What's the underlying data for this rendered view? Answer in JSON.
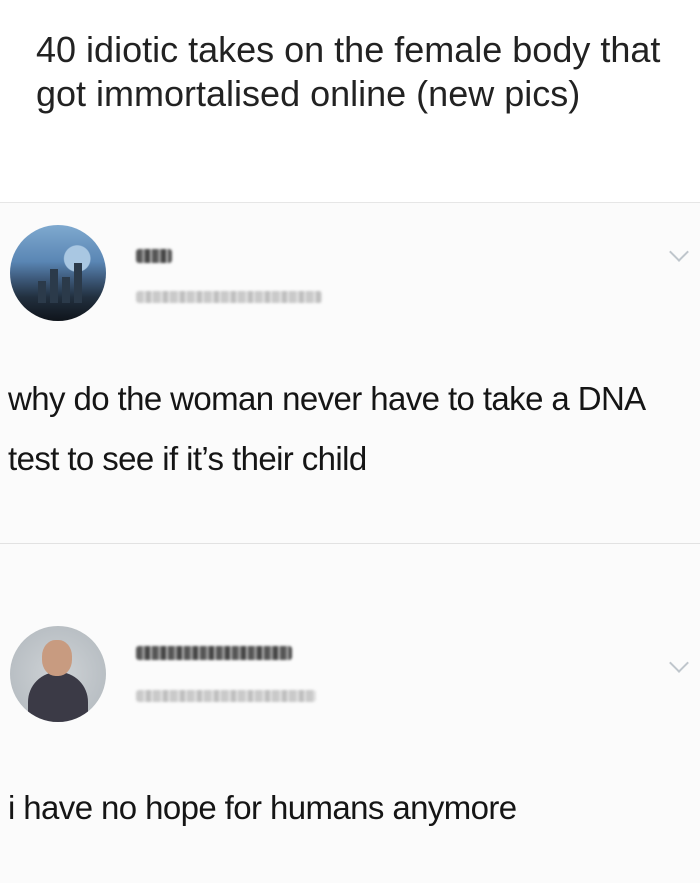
{
  "article": {
    "headline": "40 idiotic takes on the female body that got immortalised online (new pics)"
  },
  "tweets": [
    {
      "avatar_icon": "city-skyline-avatar-icon",
      "text": "why do the woman never have to take a DNA test to see if it’s their child"
    },
    {
      "avatar_icon": "person-avatar-icon",
      "text": "i have no hope for humans anymore"
    }
  ],
  "icons": {
    "more_menu": "chevron-down-icon"
  },
  "colors": {
    "background": "#ffffff",
    "text": "#151515",
    "divider": "#e6e6e6",
    "chevron": "#bfc6cc"
  }
}
